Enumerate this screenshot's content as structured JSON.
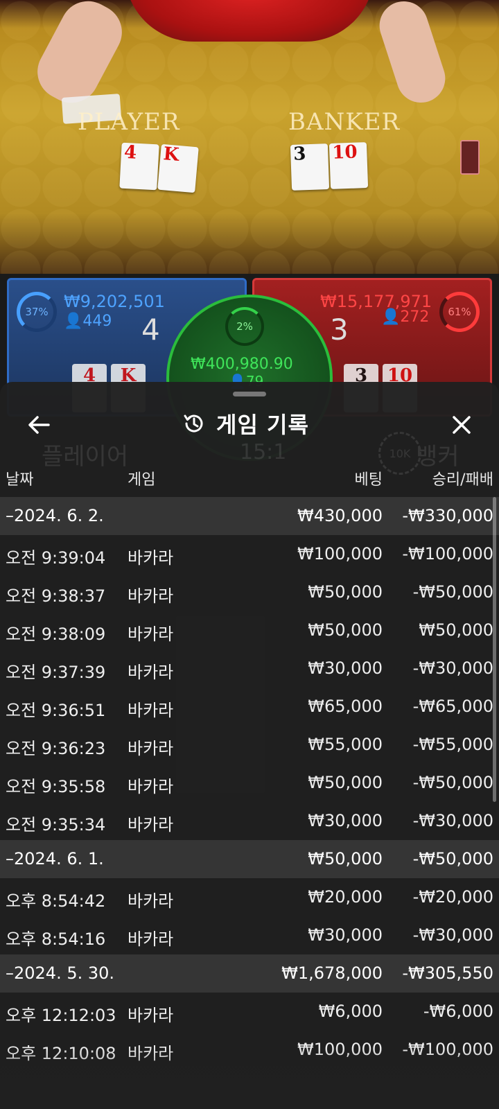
{
  "table": {
    "player_label": "PLAYER",
    "banker_label": "BANKER",
    "player_cards": [
      "4",
      "K"
    ],
    "banker_cards": [
      "3",
      "10"
    ]
  },
  "board": {
    "player": {
      "percent": "37%",
      "amount": "₩9,202,501",
      "count": "449",
      "score": "4",
      "cards": [
        "4",
        "K"
      ]
    },
    "banker": {
      "percent": "61%",
      "amount": "₩15,177,971",
      "count": "272",
      "score": "3",
      "cards": [
        "3",
        "10"
      ]
    },
    "tie": {
      "percent": "2%",
      "amount": "₩400,980.90",
      "count": "79"
    }
  },
  "sheet": {
    "title": "게임 기록",
    "columns": {
      "date": "날짜",
      "game": "게임",
      "bet": "베팅",
      "result": "승리/패배"
    },
    "rows": [
      {
        "type": "date",
        "time": "–2024. 6. 2.",
        "game": "",
        "bet": "₩430,000",
        "result": "-₩330,000"
      },
      {
        "type": "item",
        "time": "오전 9:39:04",
        "game": "바카라",
        "bet": "₩100,000",
        "result": "-₩100,000"
      },
      {
        "type": "item",
        "time": "오전 9:38:37",
        "game": "바카라",
        "bet": "₩50,000",
        "result": "-₩50,000"
      },
      {
        "type": "item",
        "time": "오전 9:38:09",
        "game": "바카라",
        "bet": "₩50,000",
        "result": "₩50,000"
      },
      {
        "type": "item",
        "time": "오전 9:37:39",
        "game": "바카라",
        "bet": "₩30,000",
        "result": "-₩30,000"
      },
      {
        "type": "item",
        "time": "오전 9:36:51",
        "game": "바카라",
        "bet": "₩65,000",
        "result": "-₩65,000"
      },
      {
        "type": "item",
        "time": "오전 9:36:23",
        "game": "바카라",
        "bet": "₩55,000",
        "result": "-₩55,000"
      },
      {
        "type": "item",
        "time": "오전 9:35:58",
        "game": "바카라",
        "bet": "₩50,000",
        "result": "-₩50,000"
      },
      {
        "type": "item",
        "time": "오전 9:35:34",
        "game": "바카라",
        "bet": "₩30,000",
        "result": "-₩30,000"
      },
      {
        "type": "date",
        "time": "–2024. 6. 1.",
        "game": "",
        "bet": "₩50,000",
        "result": "-₩50,000"
      },
      {
        "type": "item",
        "time": "오후 8:54:42",
        "game": "바카라",
        "bet": "₩20,000",
        "result": "-₩20,000"
      },
      {
        "type": "item",
        "time": "오후 8:54:16",
        "game": "바카라",
        "bet": "₩30,000",
        "result": "-₩30,000"
      },
      {
        "type": "date",
        "time": "–2024. 5. 30.",
        "game": "",
        "bet": "₩1,678,000",
        "result": "-₩305,550"
      },
      {
        "type": "item",
        "time": "오후 12:12:03",
        "game": "바카라",
        "bet": "₩6,000",
        "result": "-₩6,000"
      },
      {
        "type": "item",
        "time": "오후 12:10:08",
        "game": "바카라",
        "bet": "₩100,000",
        "result": "-₩100,000"
      }
    ]
  },
  "background": {
    "player_bet_label": "플레이어",
    "banker_bet_label": "뱅커",
    "tie_payout": "15:1",
    "chip_value": "10K"
  },
  "colors": {
    "player": "#2f6cc7",
    "banker": "#d53a3a",
    "tie": "#2bbd3c",
    "sheet_bg": "#202020"
  },
  "icons": {
    "back": "arrow-left-icon",
    "history": "history-icon",
    "close": "close-icon"
  }
}
